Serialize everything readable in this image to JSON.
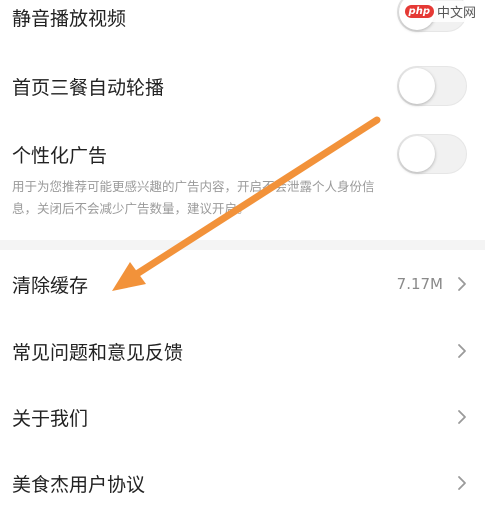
{
  "settings": {
    "mute_video": {
      "label": "静音播放视频",
      "enabled": false
    },
    "autoplay": {
      "label": "首页三餐自动轮播",
      "enabled": false
    },
    "personalized_ads": {
      "label": "个性化广告",
      "enabled": false,
      "description": "用于为您推荐可能更感兴趣的广告内容，开启不会泄露个人身份信息，关闭后不会减少广告数量，建议开启。"
    }
  },
  "menu": {
    "clear_cache": {
      "label": "清除缓存",
      "value": "7.17M"
    },
    "faq": {
      "label": "常见问题和意见反馈"
    },
    "about": {
      "label": "关于我们"
    },
    "agreement": {
      "label": "美食杰用户协议"
    }
  },
  "watermark": {
    "badge": "php",
    "text": "中文网"
  },
  "colors": {
    "arrow": "#f2923a",
    "toggle_off": "#f1f1f1",
    "text_primary": "#222222",
    "text_secondary": "#9a9a9a"
  },
  "icons": {
    "chevron": "chevron-right-icon",
    "arrow": "annotation-arrow-icon"
  }
}
